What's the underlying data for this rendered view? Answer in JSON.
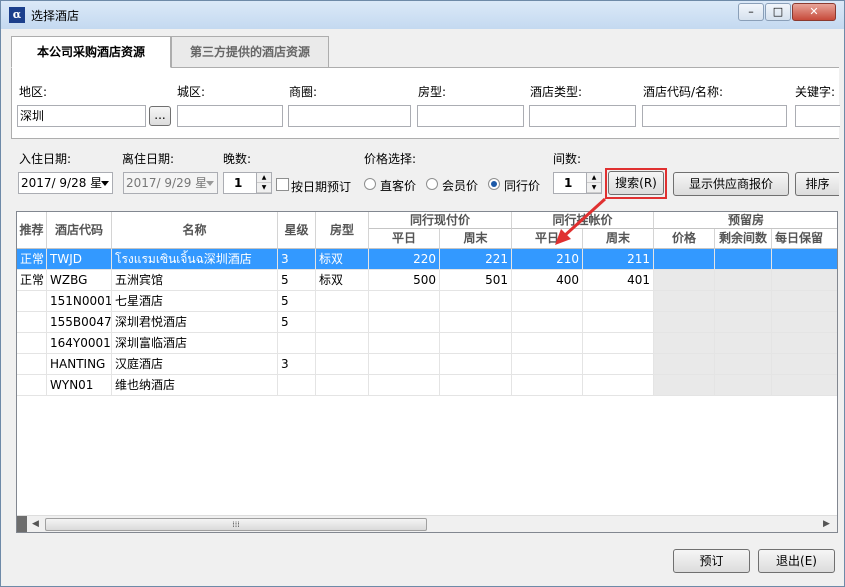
{
  "window": {
    "title": "选择酒店",
    "minimize": "–",
    "maximize": "□",
    "close": "✕"
  },
  "tabs": [
    {
      "label": "本公司采购酒店资源"
    },
    {
      "label": "第三方提供的酒店资源"
    }
  ],
  "filters": {
    "district_label": "地区:",
    "district_value": "深圳",
    "browse_label": "...",
    "city_area_label": "城区:",
    "business_area_label": "商圈:",
    "room_type_label": "房型:",
    "hotel_type_label": "酒店类型:",
    "hotel_code_label": "酒店代码/名称:",
    "keyword_label": "关键字:"
  },
  "dates": {
    "checkin_label": "入住日期:",
    "checkin_value": "2017/ 9/28 星",
    "checkout_label": "离住日期:",
    "checkout_value": "2017/ 9/29 星",
    "nights_label": "晚数:",
    "nights_value": "1",
    "by_date_label": "按日期预订",
    "price_label": "价格选择:",
    "price_options": [
      "直客价",
      "会员价",
      "同行价"
    ],
    "price_selected": "同行价",
    "rooms_label": "间数:",
    "rooms_value": "1"
  },
  "buttons": {
    "search": "搜索(R)",
    "show_supplier": "显示供应商报价",
    "sort": "排序",
    "book": "预订",
    "exit": "退出(E)"
  },
  "grid": {
    "group_headers": {
      "peer_current": "同行现付价",
      "peer_account": "同行挂帐价",
      "reserved": "预留房"
    },
    "columns": [
      "推荐",
      "酒店代码",
      "名称",
      "星级",
      "房型",
      "平日",
      "周末",
      "平日",
      "周末",
      "价格",
      "剩余间数",
      "每日保留"
    ],
    "rows": [
      {
        "rec": "正常",
        "code": "TWJD",
        "name": "โรงแรมเซินเจิ้นฉ深圳酒店",
        "star": "3",
        "room": "标双",
        "p1": "220",
        "p2": "221",
        "p3": "210",
        "p4": "211",
        "selected": true
      },
      {
        "rec": "正常",
        "code": "WZBG",
        "name": "五洲宾馆",
        "star": "5",
        "room": "标双",
        "p1": "500",
        "p2": "501",
        "p3": "400",
        "p4": "401",
        "selected": false
      },
      {
        "rec": "",
        "code": "151N0001",
        "name": "七星酒店",
        "star": "5",
        "room": "",
        "p1": "",
        "p2": "",
        "p3": "",
        "p4": "",
        "selected": false
      },
      {
        "rec": "",
        "code": "155B0047",
        "name": "深圳君悦酒店",
        "star": "5",
        "room": "",
        "p1": "",
        "p2": "",
        "p3": "",
        "p4": "",
        "selected": false
      },
      {
        "rec": "",
        "code": "164Y0001",
        "name": "深圳富临酒店",
        "star": "",
        "room": "",
        "p1": "",
        "p2": "",
        "p3": "",
        "p4": "",
        "selected": false
      },
      {
        "rec": "",
        "code": "HANTING",
        "name": "汉庭酒店",
        "star": "3",
        "room": "",
        "p1": "",
        "p2": "",
        "p3": "",
        "p4": "",
        "selected": false
      },
      {
        "rec": "",
        "code": "WYN01",
        "name": "维也纳酒店",
        "star": "",
        "room": "",
        "p1": "",
        "p2": "",
        "p3": "",
        "p4": "",
        "selected": false
      }
    ]
  },
  "colors": {
    "selection": "#3399ff",
    "highlight_box": "#e03030",
    "arrow": "#e03030"
  }
}
